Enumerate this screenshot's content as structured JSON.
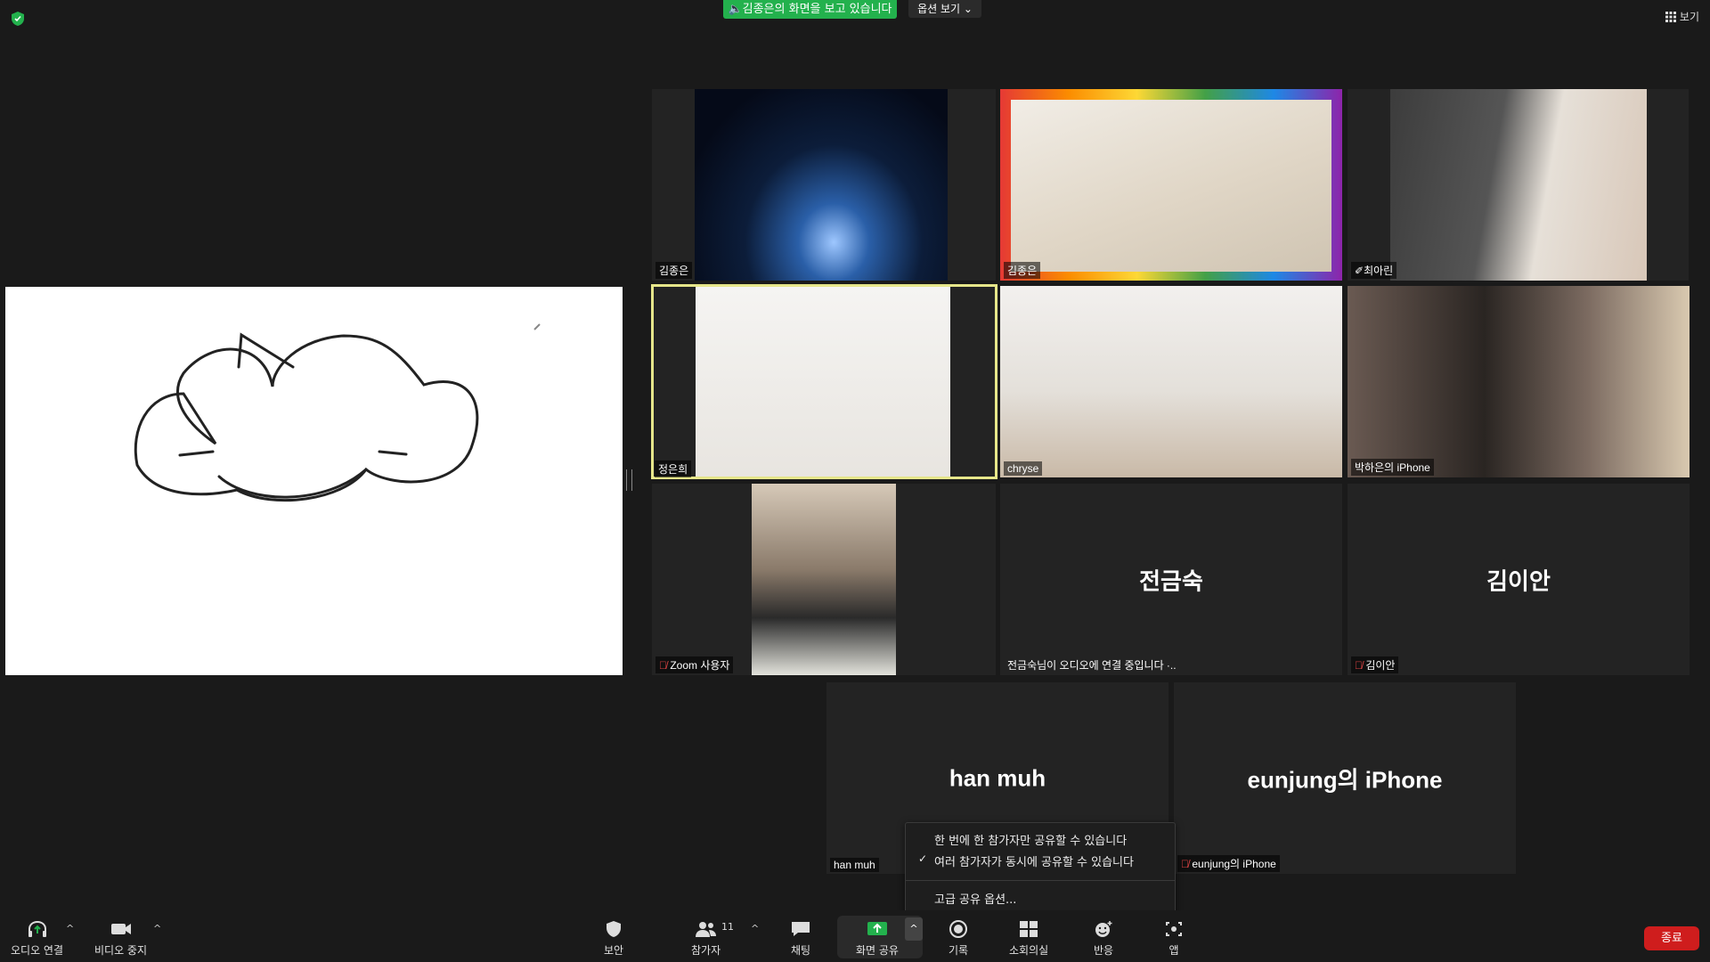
{
  "top": {
    "share_banner": "김종은의 화면을 보고 있습니다",
    "view_options": "옵션 보기",
    "view_label": "보기"
  },
  "tiles": [
    {
      "name": "김종은"
    },
    {
      "name": "김종은"
    },
    {
      "name": "최아린"
    },
    {
      "name": "정은희"
    },
    {
      "name": "chryse"
    },
    {
      "name": "박하은의 iPhone"
    },
    {
      "name": "Zoom 사용자"
    },
    {
      "big": "전금숙",
      "name": "전금숙님이 오디오에 연결 중입니다 ·.."
    },
    {
      "big": "김이안",
      "name": "김이안"
    },
    {
      "big": "han muh",
      "name": "han muh"
    },
    {
      "big": "eunjung의 iPhone",
      "name": "eunjung의 iPhone"
    }
  ],
  "menu": {
    "item1": "한 번에 한 참가자만 공유할 수 있습니다",
    "item2": "여러 참가자가 동시에 공유할 수 있습니다",
    "item3": "고급 공유 옵션..."
  },
  "toolbar": {
    "audio": "오디오 연결",
    "video": "비디오 중지",
    "security": "보안",
    "participants": "참가자",
    "participants_count": "11",
    "chat": "채팅",
    "share": "화면 공유",
    "record": "기록",
    "breakout": "소회의실",
    "reactions": "반응",
    "apps": "앱",
    "end": "종료"
  },
  "colors": {
    "background": "#1a1a1a",
    "share_green": "#23b14d",
    "end_red": "#cf1d1d",
    "active_border": "#e6e68a"
  }
}
